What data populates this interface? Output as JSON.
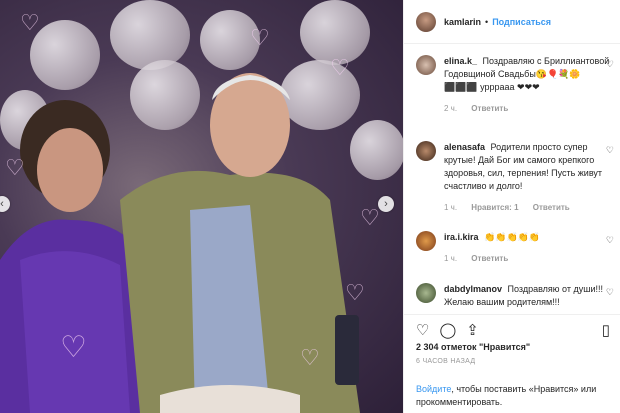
{
  "header": {
    "username": "kamlarin",
    "separator": "•",
    "follow_label": "Подписаться"
  },
  "comments": [
    {
      "user": "elina.k_",
      "text": "Поздравляю с Бриллиантовой Годовщиной Свадьбы😘🎈💐🌼 ⬛⬛⬛ урррааа ❤❤❤",
      "time": "2 ч.",
      "likes": "",
      "reply": "Ответить"
    },
    {
      "user": "alenasafa",
      "text": "Родители просто супер крутые! Дай Бог им самого крепкого здоровья, сил, терпения! Пусть живут счастливо и долго!",
      "time": "1 ч.",
      "likes": "Нравится: 1",
      "reply": "Ответить"
    },
    {
      "user": "ira.i.kira",
      "text": "👏👏👏👏👏",
      "time": "1 ч.",
      "likes": "",
      "reply": "Ответить"
    },
    {
      "user": "dabdylmanov",
      "text": "Поздравляю от души!!! Желаю вашим родителям!!!",
      "time": "",
      "likes": "",
      "reply": ""
    }
  ],
  "actions": {
    "like_icon": "heart-icon",
    "comment_icon": "comment-icon",
    "share_icon": "share-icon",
    "bookmark_icon": "bookmark-icon",
    "likes_text": "2 304 отметок \"Нравится\"",
    "time_text": "6 ЧАСОВ НАЗАД"
  },
  "login": {
    "link": "Войдите",
    "text": ", чтобы поставить «Нравится» или прокомментировать."
  },
  "media": {
    "prev_icon": "‹",
    "next_icon": "›"
  }
}
